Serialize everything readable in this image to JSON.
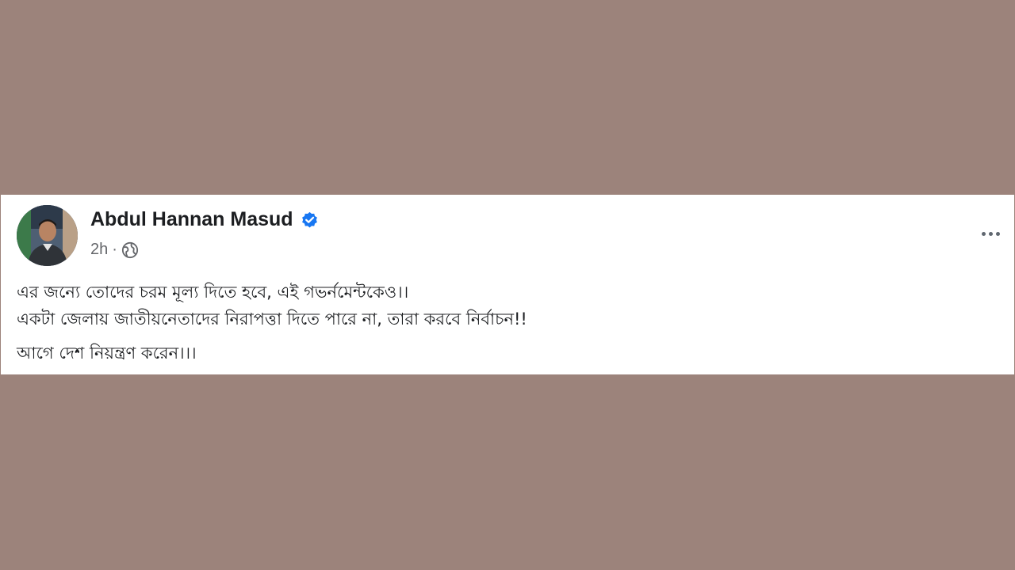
{
  "post": {
    "author": "Abdul Hannan Masud",
    "verified": true,
    "time": "2h",
    "separator": "·",
    "audience_icon": "globe-icon",
    "more_icon": "more-options-icon",
    "lines": [
      "এর জন্যে তোদের চরম মূল্য দিতে হবে, এই গভর্নমেন্টকেও।।",
      "একটা জেলায় জাতীয়নেতাদের নিরাপত্তা দিতে পারে না, তারা করবে নির্বাচন!!",
      "আগে দেশ নিয়ন্ত্রণ করেন।।।"
    ]
  },
  "colors": {
    "background": "#9c837b",
    "card": "#ffffff",
    "verified_badge": "#1877f2",
    "meta_text": "#65676b"
  }
}
